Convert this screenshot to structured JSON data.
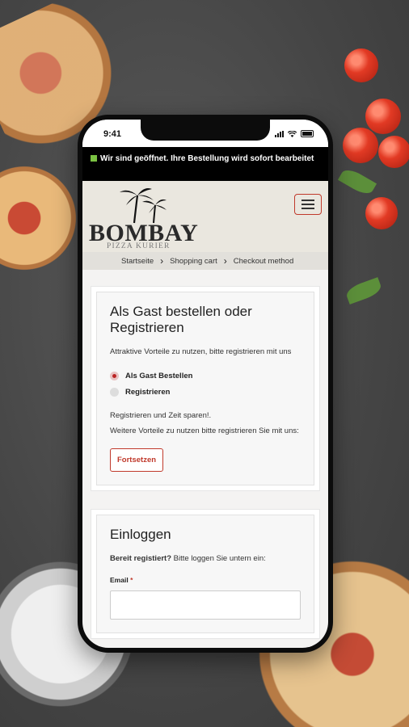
{
  "status": {
    "time": "9:41"
  },
  "announcement": "Wir sind geöffnet. Ihre Bestellung wird sofort bearbeitet",
  "brand": {
    "name": "BOMBAY",
    "subtitle": "PIZZA KURIER"
  },
  "breadcrumb": [
    "Startseite",
    "Shopping cart",
    "Checkout method"
  ],
  "guest": {
    "title": "Als Gast bestellen oder Registrieren",
    "intro": "Attraktive Vorteile zu nutzen, bitte registrieren mit uns",
    "options": [
      {
        "label": "Als Gast Bestellen",
        "checked": true
      },
      {
        "label": "Registrieren",
        "checked": false
      }
    ],
    "note1": "Registrieren und Zeit sparen!.",
    "note2": "Weitere Vorteile zu nutzen bitte registrieren Sie mit uns:",
    "button": "Fortsetzen"
  },
  "login": {
    "title": "Einloggen",
    "lead_bold": "Bereit registiert?",
    "lead_rest": "Bitte loggen Sie untern ein:",
    "email_label": "Email",
    "required_mark": "*"
  },
  "colors": {
    "accent": "#c0392b",
    "open_dot": "#7ac142"
  }
}
